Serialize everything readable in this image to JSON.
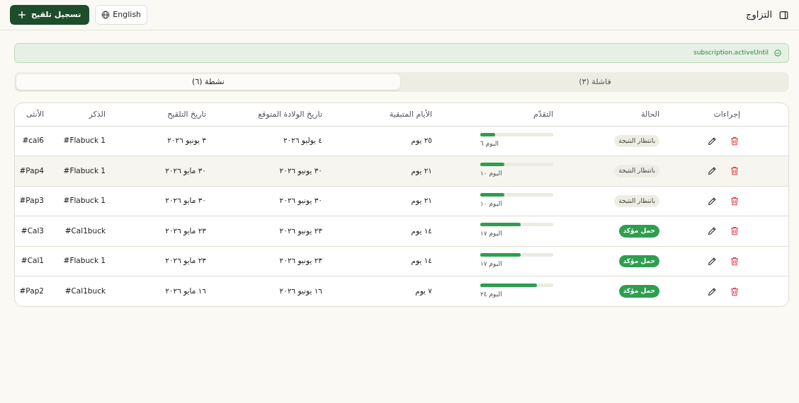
{
  "header": {
    "title": "التزاوج",
    "language_button": "English",
    "add_button": "تسجيل تلقيح"
  },
  "alert": {
    "text": "subscription.activeUntil"
  },
  "tabs": [
    {
      "label": "فاشلة (٣)",
      "selected": false
    },
    {
      "label": "نشطة (٦)",
      "selected": true
    }
  ],
  "table": {
    "columns": [
      "إجراءات",
      "الحالة",
      "التقدّم",
      "الأيام المتبقية",
      "تاريخ الولادة المتوقع",
      "تاريخ التلقيح",
      "الذكر",
      "الأنثى"
    ],
    "rows": [
      {
        "hovered": false,
        "status": {
          "kind": "pending",
          "label": "بانتظار النتيجة"
        },
        "progress": {
          "level": 0.2,
          "label": "اليوم ٦"
        },
        "days_left": "٢٥ يوم",
        "due_date": "٤ يوليو ٢٠٢٦",
        "mating_date": "٣ يونيو ٢٠٢٦",
        "male": "#Flabuck 1",
        "female": "#cal6"
      },
      {
        "hovered": true,
        "status": {
          "kind": "pending",
          "label": "بانتظار النتيجة"
        },
        "progress": {
          "level": 0.33,
          "label": "اليوم ١٠"
        },
        "days_left": "٢١ يوم",
        "due_date": "٣٠ يونيو ٢٠٢٦",
        "mating_date": "٣٠ مايو ٢٠٢٦",
        "male": "#Flabuck 1",
        "female": "#Pap4"
      },
      {
        "hovered": false,
        "status": {
          "kind": "pending",
          "label": "بانتظار النتيجة"
        },
        "progress": {
          "level": 0.33,
          "label": "اليوم ١٠"
        },
        "days_left": "٢١ يوم",
        "due_date": "٣٠ يونيو ٢٠٢٦",
        "mating_date": "٣٠ مايو ٢٠٢٦",
        "male": "#Flabuck 1",
        "female": "#Pap3"
      },
      {
        "hovered": false,
        "status": {
          "kind": "confirmed",
          "label": "حمل مؤكد"
        },
        "progress": {
          "level": 0.55,
          "label": "اليوم ١٧"
        },
        "days_left": "١٤ يوم",
        "due_date": "٢٣ يونيو ٢٠٢٦",
        "mating_date": "٢٣ مايو ٢٠٢٦",
        "male": "#Cal1buck",
        "female": "#Cal3"
      },
      {
        "hovered": false,
        "status": {
          "kind": "confirmed",
          "label": "حمل مؤكد"
        },
        "progress": {
          "level": 0.55,
          "label": "اليوم ١٧"
        },
        "days_left": "١٤ يوم",
        "due_date": "٢٣ يونيو ٢٠٢٦",
        "mating_date": "٢٣ مايو ٢٠٢٦",
        "male": "#Flabuck 1",
        "female": "#Cal1"
      },
      {
        "hovered": false,
        "status": {
          "kind": "confirmed",
          "label": "حمل مؤكد"
        },
        "progress": {
          "level": 0.78,
          "label": "اليوم ٢٤"
        },
        "days_left": "٧ يوم",
        "due_date": "١٦ يونيو ٢٠٢٦",
        "mating_date": "١٦ مايو ٢٠٢٦",
        "male": "#Cal1buck",
        "female": "#Pap2"
      }
    ]
  }
}
